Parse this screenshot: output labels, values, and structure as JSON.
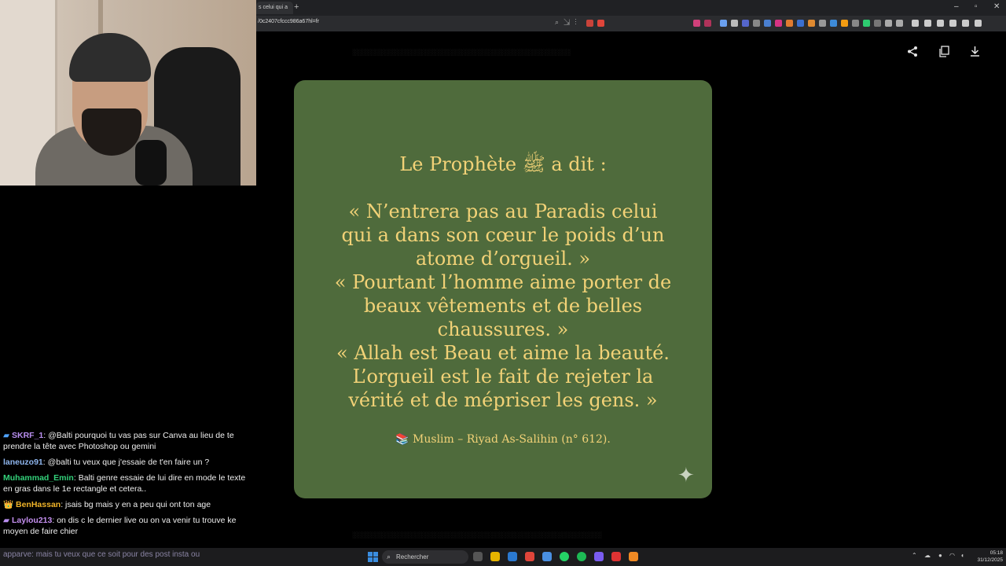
{
  "browser": {
    "tab_title": "s celui qui a",
    "new_tab": "+",
    "url": "/0c2407cfccc986a67hl=fr",
    "window_controls": [
      "–",
      "▫",
      "✕"
    ]
  },
  "viewer": {
    "share_icon": "share-icon",
    "copy_icon": "copy-icon",
    "download_icon": "download-icon"
  },
  "card": {
    "background": "#4f6b3c",
    "text_color": "#f2d277",
    "title": "Le Prophète ﷺ a dit :",
    "quote_lines": [
      "« N’entrera pas au Paradis celui",
      "qui a dans son cœur le poids d’un",
      "atome d’orgueil. »",
      "« Pourtant l’homme aime porter de",
      "beaux vêtements et de belles",
      "chaussures. »",
      "« Allah est Beau et aime la beauté.",
      "L’orgueil est le fait de rejeter la",
      "vérité et de mépriser les gens. »"
    ],
    "source": "📚 Muslim – Riyad As-Salihin (n° 612).",
    "sparkle": "✦"
  },
  "chat": [
    {
      "badge": "▰",
      "user": "SKRF_1",
      "color": "#b98ff0",
      "text": "@Balti pourquoi tu vas pas sur Canva au lieu de te prendre la tête avec Photoshop ou gemini"
    },
    {
      "badge": "",
      "user": "laneuzo91",
      "color": "#8fb6ef",
      "text": "@balti tu veux que j'essaie de t'en faire un ?"
    },
    {
      "badge": "",
      "user": "Muhammad_Emin",
      "color": "#33d17a",
      "text": "Balti genre essaie de lui dire en mode le texte en gras dans le 1e rectangle et cetera.."
    },
    {
      "badge": "👑",
      "user": "BenHassan",
      "color": "#f0b429",
      "text": "jsais bg mais y en a peu qui ont ton age"
    },
    {
      "badge": "▰",
      "user": "Laylou213",
      "color": "#c48fef",
      "text": "on dis c le dernier live ou on va venir tu trouve ke moyen de faire chier"
    }
  ],
  "taskbar": {
    "overlay_chat": "apparve: mais tu veux que ce soit pour des post insta ou",
    "search_placeholder": "Rechercher",
    "time": "05:18",
    "date": "31/12/2025"
  }
}
